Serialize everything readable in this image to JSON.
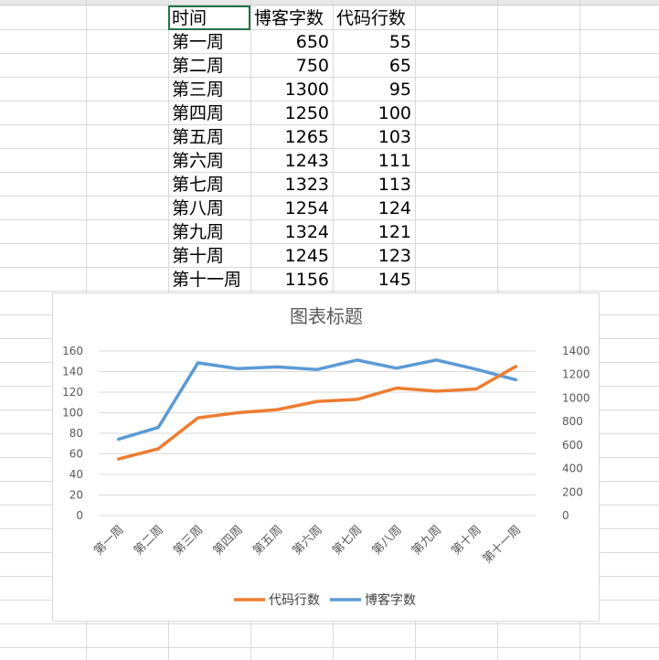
{
  "table": {
    "headers": [
      "时间",
      "博客字数",
      "代码行数"
    ],
    "rows": [
      [
        "第一周",
        "650",
        "55"
      ],
      [
        "第二周",
        "750",
        "65"
      ],
      [
        "第三周",
        "1300",
        "95"
      ],
      [
        "第四周",
        "1250",
        "100"
      ],
      [
        "第五周",
        "1265",
        "103"
      ],
      [
        "第六周",
        "1243",
        "111"
      ],
      [
        "第七周",
        "1323",
        "113"
      ],
      [
        "第八周",
        "1254",
        "124"
      ],
      [
        "第九周",
        "1324",
        "121"
      ],
      [
        "第十周",
        "1245",
        "123"
      ],
      [
        "第十一周",
        "1156",
        "145"
      ]
    ]
  },
  "chart_data": {
    "type": "line",
    "title": "图表标题",
    "categories": [
      "第一周",
      "第二周",
      "第三周",
      "第四周",
      "第五周",
      "第六周",
      "第七周",
      "第八周",
      "第九周",
      "第十周",
      "第十一周"
    ],
    "series": [
      {
        "name": "代码行数",
        "axis": "left",
        "color": "#ed7d31",
        "values": [
          55,
          65,
          95,
          100,
          103,
          111,
          113,
          124,
          121,
          123,
          145
        ]
      },
      {
        "name": "博客字数",
        "axis": "right",
        "color": "#5b9bd5",
        "values": [
          650,
          750,
          1300,
          1250,
          1265,
          1243,
          1323,
          1254,
          1324,
          1245,
          1156
        ]
      }
    ],
    "y_left": {
      "min": 0,
      "max": 160,
      "step": 20,
      "ticks": [
        "0",
        "20",
        "40",
        "60",
        "80",
        "100",
        "120",
        "140",
        "160"
      ]
    },
    "y_right": {
      "min": 0,
      "max": 1400,
      "step": 200,
      "ticks": [
        "0",
        "200",
        "400",
        "600",
        "800",
        "1000",
        "1200",
        "1400"
      ]
    },
    "grid": true,
    "legend": "bottom"
  }
}
